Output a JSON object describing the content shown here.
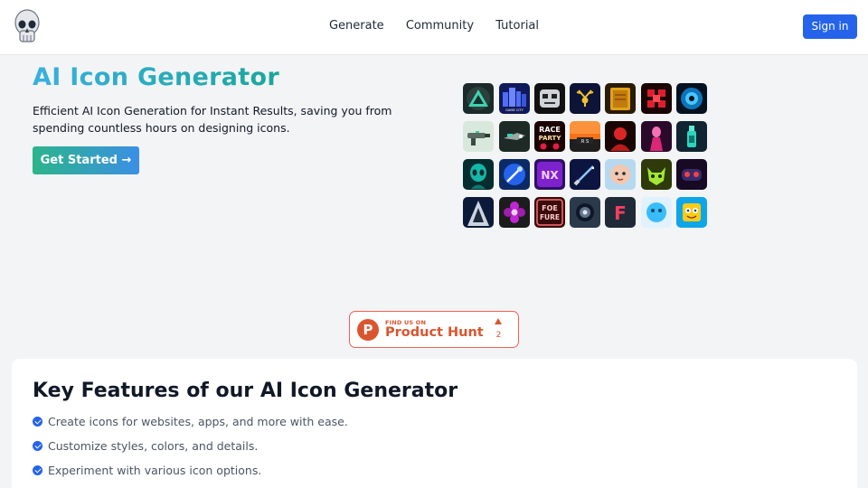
{
  "nav": {
    "logo": "skull-icon",
    "links": [
      "Generate",
      "Community",
      "Tutorial"
    ],
    "signin_label": "Sign in"
  },
  "hero": {
    "title": "AI Icon Generator",
    "description": "Efficient AI Icon Generation for Instant Results, saving you from spending countless hours on designing icons.",
    "cta_label": "Get Started →"
  },
  "gallery": {
    "icons": [
      [
        "triangle-emblem-icon",
        "game-city-icon",
        "robot-face-icon",
        "deer-antlers-icon",
        "notebook-icon",
        "red-dice-icon",
        "eye-icon"
      ],
      [
        "blaster-gun-icon",
        "spaceship-icon",
        "race-party-icon",
        "sunset-ride-icon",
        "red-portrait-icon",
        "pink-figure-icon",
        "bottle-icon"
      ],
      [
        "alien-face-icon",
        "comet-icon",
        "nx-letters-icon",
        "lightsaber-icon",
        "baby-face-icon",
        "mech-cat-icon",
        "gamepad-robot-icon"
      ],
      [
        "wizard-hood-icon",
        "pink-flower-icon",
        "foe-fure-icon",
        "alien-orb-icon",
        "letter-f-icon",
        "blue-blob-icon",
        "sponge-face-icon"
      ]
    ],
    "labels": {
      "game_city": "GAME CITY",
      "race_party_1": "RACE",
      "race_party_2": "PARTY",
      "nx": "NX",
      "foe": "FOE",
      "fure": "FURE",
      "letter_f": "F",
      "sunset_sign": "R S"
    }
  },
  "product_hunt": {
    "small_text": "FIND US ON",
    "big_text": "Product Hunt",
    "logo_letter": "P",
    "count": "2"
  },
  "features": {
    "title": "Key Features of our AI Icon Generator",
    "items": [
      "Create icons for websites, apps, and more with ease.",
      "Customize styles, colors, and details.",
      "Experiment with various icon options."
    ]
  },
  "colors": {
    "accent": "#2563eb",
    "title_gradient_start": "#3ab0e0",
    "title_gradient_end": "#1aa79a",
    "product_hunt": "#da552f"
  }
}
